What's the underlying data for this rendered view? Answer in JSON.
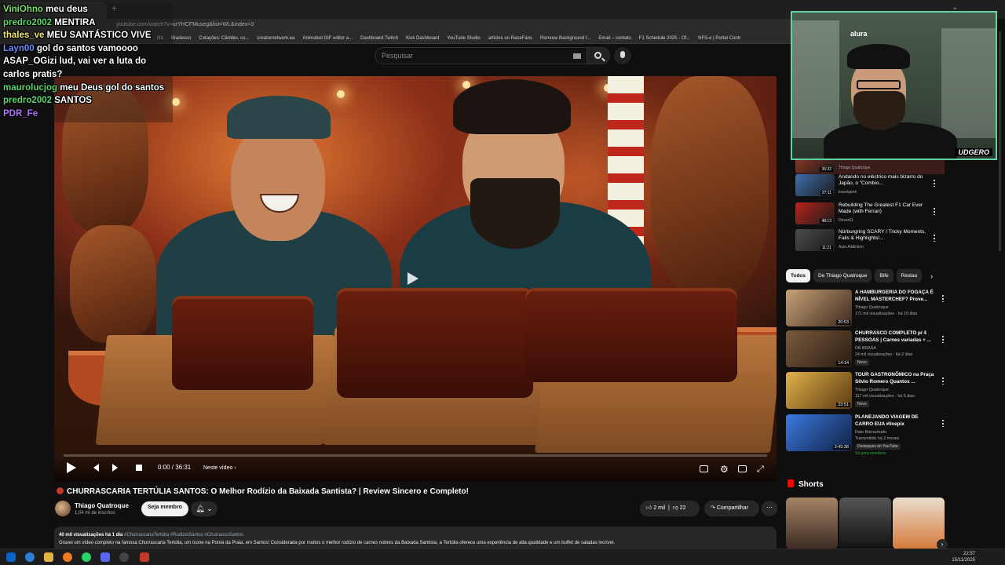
{
  "browser": {
    "url": "youtube.com/watch?v=urYHCFMuseg&list=WL&index=3",
    "tab_title": "",
    "bookmarks": [
      "G1",
      "Bradesco",
      "Cotações: Câmbio, co...",
      "creatornetwork.ea",
      "Animated GIF editor a...",
      "Dashboard Twitch",
      "Kick Dashboard",
      "YouTube Studio",
      "articles on RaceFans",
      "Remove Background f...",
      "Email – contato",
      "F1 Schedule 2025 - Of...",
      "NFS-e | Portal Contr"
    ]
  },
  "search": {
    "placeholder": "Pesquisar"
  },
  "player": {
    "time": "0:00 / 36:31",
    "next_label": "Neste vídeo",
    "progress_fraction": 0
  },
  "video": {
    "title": "CHURRASCARIA TERTÚLIA SANTOS: O Melhor Rodízio da Baixada Santista? | Review Sincero e Completo!",
    "channel": "Thiago Quatroque",
    "subscribers": "1,04 mi de inscritos",
    "member_button": "Seja membro",
    "likes": "2 mil",
    "dislikes": "22",
    "share": "Compartilhar",
    "desc_stats": "40 mil visualizações  há 1 dia",
    "desc_tags": "#ChurrascariaTertúlia #RodizioSantos #ChurrascoSantos",
    "desc_text": "Gravei um vídeo completo na famosa Churrascaria Tertúlia, um ícone na Ponta da Praia, em Santos! Considerada por muitos o melhor rodízio de carnes nobres da Baixada Santista, a Tertúlia oferece uma experiência de alta qualidade e um buffet de saladas incrível."
  },
  "playlist": [
    {
      "title": "",
      "channel": "Thiago Quatroque",
      "duration": "36:32"
    },
    {
      "title": "Andando no eléctrico mais bizarro do Japão, o \"Combio...",
      "channel": "travelgeek",
      "duration": "27:11"
    },
    {
      "title": "Rebuilding The Greatest F1 Car Ever Made (with Ferrari)",
      "channel": "Driver61",
      "duration": "48:13"
    },
    {
      "title": "Nürburgring SCARY / Tricky Moments, Fails & Highlights!...",
      "channel": "Auto Addiction",
      "duration": "11:21"
    }
  ],
  "chips": [
    "Todos",
    "De Thiago Quatroque",
    "Bife",
    "Restau"
  ],
  "recommendations": [
    {
      "title": "A HAMBURGERIA DO FOGAÇA É NÍVEL MASTERCHEF? Prove...",
      "channel": "Thiago Quatroque",
      "meta": "171 mil visualizações · há 10 dias",
      "duration": "20:53",
      "badge": ""
    },
    {
      "title": "CHURRASCO COMPLETO p/ 4 PESSOAS | Carnes variadas + ...",
      "channel": "DB BRASA",
      "meta": "24 mil visualizações · há 2 dias",
      "duration": "14:14",
      "badge": "Novo"
    },
    {
      "title": "TOUR GASTRONÔMICO na Praça Silvio Romero Quantos ...",
      "channel": "Thiago Quatroque",
      "meta": "117 mil visualizações · há 5 dias",
      "duration": "23:51",
      "badge": "Novo"
    },
    {
      "title": "PLANEJANDO VIAGEM DE CARRO EUA #livepix",
      "channel": "Rato Borrachudo",
      "meta": "Transmitido há 2 meses",
      "duration": "3:43:38",
      "badge": "Destaques do YouTube",
      "members": "Só para membros"
    }
  ],
  "shorts": {
    "title": "Shorts"
  },
  "webcam": {
    "label": "UDGERO",
    "logo": "alura"
  },
  "chat": [
    {
      "user": "ViniOhno",
      "text": "meu deus",
      "color": "#7be36a"
    },
    {
      "user": "predro2002",
      "text": "MENTIRA",
      "color": "#5cd66a"
    },
    {
      "user": "thales_ve",
      "text": "MEU SANTÁSTICO VIVE",
      "color": "#f1e66a"
    },
    {
      "user": "Layn00",
      "text": "gol do santos vamoooo",
      "color": "#6a8cff"
    },
    {
      "user": "ASAP_OGizi",
      "text": "lud, vai ver a luta do carlos pratis?",
      "color": "#ffffff"
    },
    {
      "user": "maurolucjog",
      "text": "meu Deus gol do santos",
      "color": "#5cd66a"
    },
    {
      "user": "predro2002",
      "text": "SANTOS",
      "color": "#5cd66a"
    },
    {
      "user": "PDR_Fe",
      "text": "",
      "color": "#b072ff"
    }
  ],
  "taskbar": {
    "time": "22:57",
    "date": "15/11/2025"
  },
  "colors": {
    "accent": "#ff0000",
    "bg": "#0f0f0f"
  }
}
